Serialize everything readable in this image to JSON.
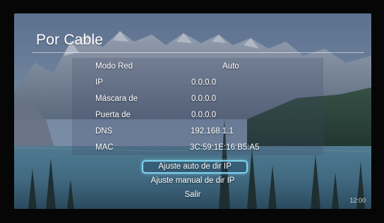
{
  "screen": {
    "title": "Por Cable",
    "clock": "12:00"
  },
  "network": {
    "rows": [
      {
        "label": "Modo Red",
        "value": "Auto"
      },
      {
        "label": "IP",
        "value": "0.0.0.0"
      },
      {
        "label": "Máscara de",
        "value": "0.0.0.0"
      },
      {
        "label": "Puerta de",
        "value": "0.0.0.0"
      },
      {
        "label": "DNS",
        "value": "192.168.1.1"
      },
      {
        "label": "MAC",
        "value": "3C:59:1E:16:B5:A5"
      }
    ]
  },
  "menu": {
    "items": [
      {
        "label": "Ajuste auto de dir IP",
        "selected": true
      },
      {
        "label": "Ajuste manual de dir IP",
        "selected": false
      },
      {
        "label": "Salir",
        "selected": false
      }
    ]
  },
  "colors": {
    "focus_border": "#7fd2ef",
    "text": "#ffffff"
  }
}
